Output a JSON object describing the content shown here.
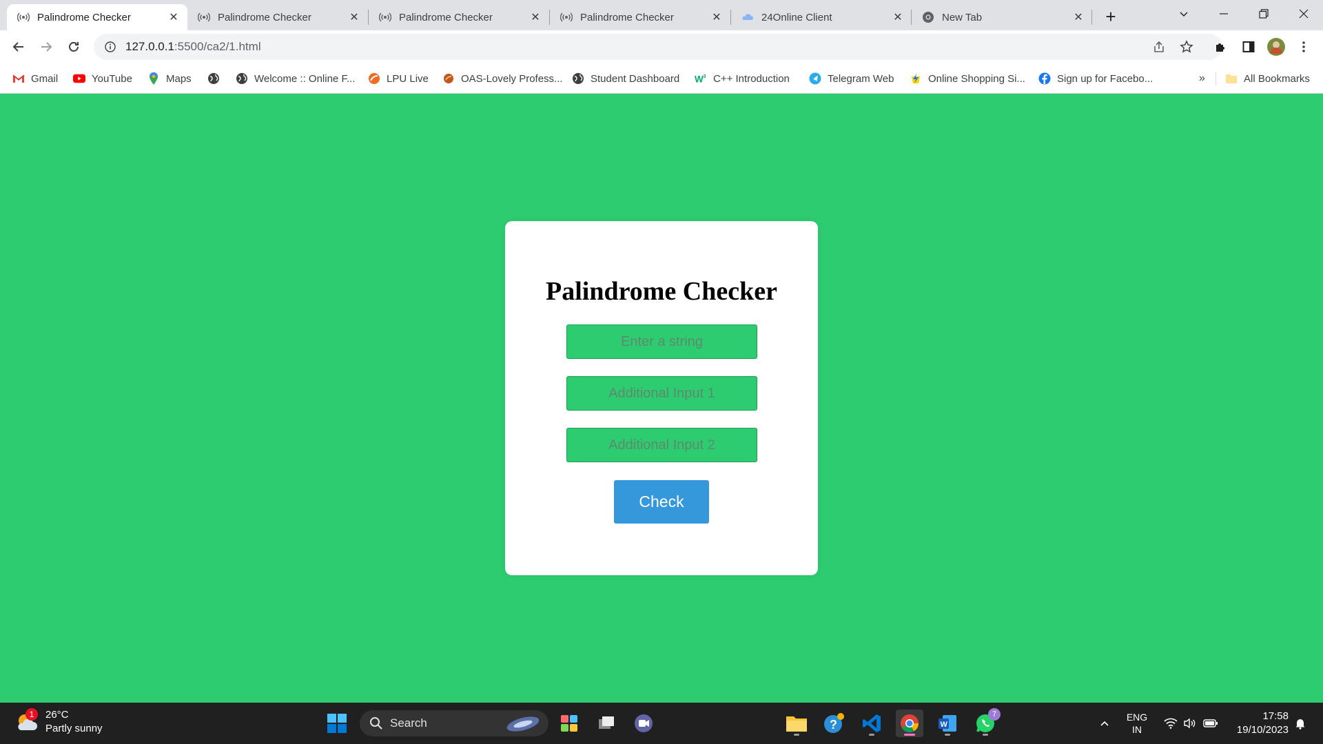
{
  "browser": {
    "tabs": [
      {
        "title": "Palindrome Checker",
        "icon": "broadcast-icon",
        "active": true
      },
      {
        "title": "Palindrome Checker",
        "icon": "broadcast-icon",
        "active": false
      },
      {
        "title": "Palindrome Checker",
        "icon": "broadcast-icon",
        "active": false
      },
      {
        "title": "Palindrome Checker",
        "icon": "broadcast-icon",
        "active": false
      },
      {
        "title": "24Online Client",
        "icon": "cloud-icon",
        "active": false
      },
      {
        "title": "New Tab",
        "icon": "chrome-icon",
        "active": false
      }
    ],
    "close_glyph": "✕",
    "new_tab_glyph": "+",
    "url_host": "127.0.0.1",
    "url_path": ":5500/ca2/1.html"
  },
  "bookmarks": [
    {
      "label": "Gmail",
      "icon": "gmail-icon"
    },
    {
      "label": "YouTube",
      "icon": "youtube-icon"
    },
    {
      "label": "Maps",
      "icon": "maps-icon"
    },
    {
      "label": "",
      "icon": "globe-icon"
    },
    {
      "label": "Welcome :: Online F...",
      "icon": "globe-icon"
    },
    {
      "label": "LPU Live",
      "icon": "lpu-icon"
    },
    {
      "label": "OAS-Lovely Profess...",
      "icon": "oas-icon"
    },
    {
      "label": "Student Dashboard",
      "icon": "globe-icon"
    },
    {
      "label": "C++ Introduction",
      "icon": "w3schools-icon"
    },
    {
      "label": "Telegram Web",
      "icon": "telegram-icon"
    },
    {
      "label": "Online Shopping Si...",
      "icon": "flipkart-icon"
    },
    {
      "label": "Sign up for Facebo...",
      "icon": "facebook-icon"
    }
  ],
  "bookmarks_overflow": "»",
  "all_bookmarks": "All Bookmarks",
  "page": {
    "background": "#2ecc71",
    "title": "Palindrome Checker",
    "input_main_placeholder": "Enter a string",
    "input_1_placeholder": "Additional Input 1",
    "input_2_placeholder": "Additional Input 2",
    "check_label": "Check",
    "button_color": "#3498db"
  },
  "taskbar": {
    "weather_temp": "26°C",
    "weather_desc": "Partly sunny",
    "weather_badge": "1",
    "search_label": "Search",
    "whatsapp_badge": "7",
    "lang_line1": "ENG",
    "lang_line2": "IN",
    "time": "17:58",
    "date": "19/10/2023"
  }
}
